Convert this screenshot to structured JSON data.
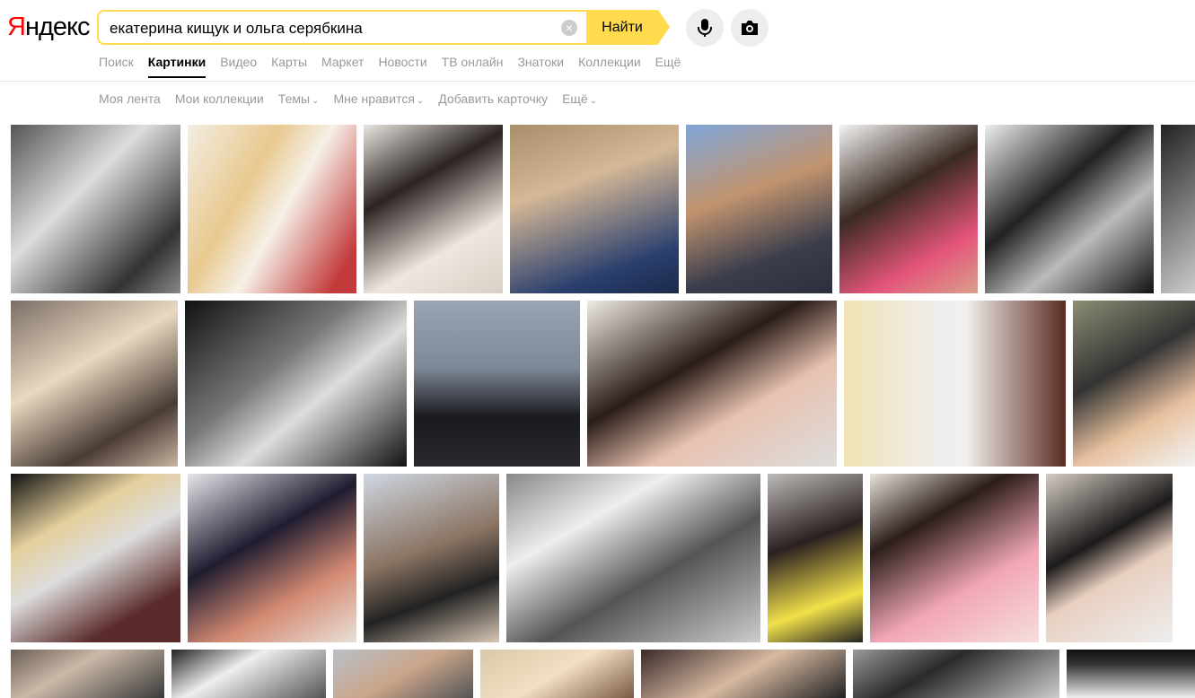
{
  "logo": {
    "first": "Я",
    "rest": "ндекс"
  },
  "search": {
    "value": "екатерина кищук и ольга серябкина",
    "clear_icon": "×",
    "button_label": "Найти"
  },
  "nav": {
    "items": [
      "Поиск",
      "Картинки",
      "Видео",
      "Карты",
      "Маркет",
      "Новости",
      "ТВ онлайн",
      "Знатоки",
      "Коллекции",
      "Ещё"
    ],
    "active": "Картинки"
  },
  "subnav": {
    "items": [
      {
        "label": "Моя лента",
        "dropdown": false
      },
      {
        "label": "Мои коллекции",
        "dropdown": false
      },
      {
        "label": "Темы",
        "dropdown": true
      },
      {
        "label": "Мне нравится",
        "dropdown": true
      },
      {
        "label": "Добавить карточку",
        "dropdown": false
      },
      {
        "label": "Ещё",
        "dropdown": true
      }
    ]
  },
  "colors": {
    "accent": "#ffdb4d",
    "logo_red": "#ff0000"
  },
  "images": [
    {
      "name": "image-result",
      "bg": "linear-gradient(135deg,#555,#ddd 40%,#333 80%,#888)"
    },
    {
      "name": "image-result",
      "bg": "linear-gradient(120deg,#f3ede2,#e8c98f 35%,#f6f0e8 55%,#c23a3a 90%)"
    },
    {
      "name": "image-result",
      "bg": "linear-gradient(150deg,#e9e5e0,#2b2422 35%,#efe6df 70%,#d9cfc6)"
    },
    {
      "name": "image-result",
      "bg": "linear-gradient(160deg,#a88e6a,#d5b896 35%,#2a3f6e 80%,#1c2a4a)"
    },
    {
      "name": "image-result",
      "bg": "linear-gradient(160deg,#7fa6d8,#c2946f 40%,#3a3d4c 75%,#2c2f3e)"
    },
    {
      "name": "image-result",
      "bg": "linear-gradient(150deg,#f4f4f4,#3a2a22 40%,#e4557a 75%,#d9a08a)"
    },
    {
      "name": "image-result",
      "bg": "linear-gradient(140deg,#eee,#222 40%,#bbb 65%,#111)"
    },
    {
      "name": "image-result",
      "bg": "linear-gradient(140deg,#222,#ccc)"
    },
    {
      "name": "image-result",
      "bg": "linear-gradient(150deg,#7c6e66,#e8d9c0 40%,#4a3b35 75%,#c7b4a0)"
    },
    {
      "name": "image-result",
      "bg": "linear-gradient(140deg,#111,#777 40%,#ddd 60%,#111)"
    },
    {
      "name": "image-result",
      "bg": "linear-gradient(180deg,#9aa5b4,#7e8998 40%,#1b1b1f 70%,#2a2a2e)"
    },
    {
      "name": "image-result",
      "bg": "linear-gradient(150deg,#f0ebe6,#2a1c18 40%,#e7c2b0 65%,#ddd)"
    },
    {
      "name": "image-result",
      "bg": "linear-gradient(90deg,#f1e3b6,#eee 45%,#f2f0ec 55%,#5a2b22)"
    },
    {
      "name": "image-result",
      "bg": "linear-gradient(150deg,#8a8f73,#333 40%,#e8c19f 70%,#f3f3f3)"
    },
    {
      "name": "image-result",
      "bg": "linear-gradient(150deg,#111,#e4cf9c 30%,#ddd 50%,#5b2b2b 80%)"
    },
    {
      "name": "image-result",
      "bg": "linear-gradient(150deg,#e7e5ea,#1f1c30 40%,#d48a73 70%,#e8e0d8)"
    },
    {
      "name": "image-result",
      "bg": "linear-gradient(160deg,#cfd7e2,#8a7463 45%,#222 70%,#d9c7b5)"
    },
    {
      "name": "image-result",
      "bg": "linear-gradient(150deg,#888,#eee 30%,#555 60%,#ccc)"
    },
    {
      "name": "image-result",
      "bg": "linear-gradient(160deg,#bdbab8,#2a2020 40%,#f2e14a 75%,#222)"
    },
    {
      "name": "image-result",
      "bg": "linear-gradient(150deg,#e8e2dc,#2b1d1a 30%,#f2a6b8 65%,#f5dede)"
    },
    {
      "name": "image-result",
      "bg": "linear-gradient(150deg,#d5cdc4,#1c1a1a 40%,#e8cfc0 60%,#eee)"
    },
    {
      "name": "image-result",
      "bg": "linear-gradient(150deg,#6b5e55,#cbb9a8 40%,#3a3a3a)"
    },
    {
      "name": "image-result",
      "bg": "linear-gradient(150deg,#222,#eee 40%,#555)"
    },
    {
      "name": "image-result",
      "bg": "linear-gradient(150deg,#b8c0c8,#caa58a 50%,#555)"
    },
    {
      "name": "image-result",
      "bg": "linear-gradient(150deg,#d9c9a8,#f3dfc4 50%,#7a5a45)"
    },
    {
      "name": "image-result",
      "bg": "linear-gradient(150deg,#3a2a2a,#d7b9a1 50%,#222)"
    },
    {
      "name": "image-result",
      "bg": "linear-gradient(150deg,#999,#2a2a2a 40%,#ccc)"
    },
    {
      "name": "image-result",
      "bg": "linear-gradient(180deg,#111,#333 30%,#eee)"
    },
    {
      "name": "image-result",
      "bg": "linear-gradient(150deg,#5a4a48,#c9b3a8 50%,#2a2222)"
    }
  ]
}
